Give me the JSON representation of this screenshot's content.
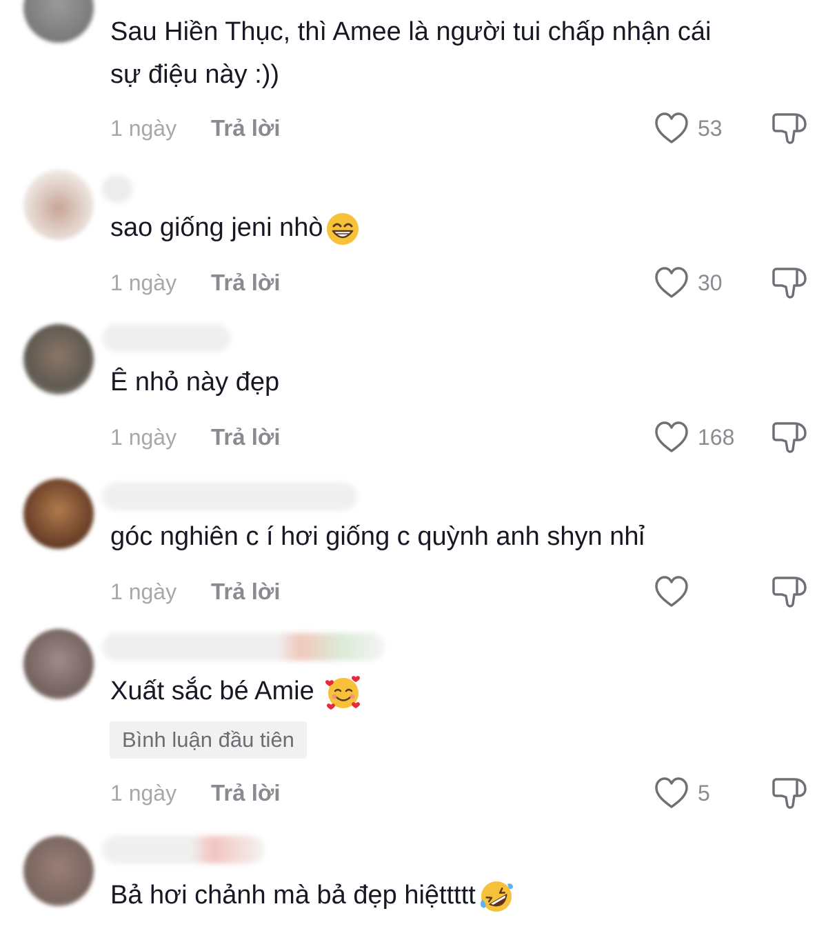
{
  "comments": [
    {
      "text": "Sau Hiền Thục, thì Amee là người tui chấp nhận cái",
      "text2": "sự điệu này :))",
      "time": "1 ngày",
      "reply_label": "Trả lời",
      "likes": "53"
    },
    {
      "text": "sao giống jeni nhò",
      "emoji": "grinning-face-with-smiling-eyes",
      "time": "1 ngày",
      "reply_label": "Trả lời",
      "likes": "30"
    },
    {
      "text": "Ê nhỏ này đẹp",
      "time": "1 ngày",
      "reply_label": "Trả lời",
      "likes": "168"
    },
    {
      "text": "góc nghiên c í hơi giống c quỳnh anh shyn nhỉ",
      "time": "1 ngày",
      "reply_label": "Trả lời",
      "likes": ""
    },
    {
      "text": "Xuất sắc bé Amie",
      "emoji": "smiling-face-with-hearts",
      "badge": "Bình luận đầu tiên",
      "time": "1 ngày",
      "reply_label": "Trả lời",
      "likes": "5"
    },
    {
      "text": "Bả hơi chảnh mà bả đẹp hiệttttt",
      "emoji": "rolling-on-the-floor-laughing"
    }
  ],
  "colors": {
    "text": "#161823",
    "meta": "#a6a7ab",
    "reply": "#8a8b91",
    "badge_bg": "#f1f1f2"
  }
}
